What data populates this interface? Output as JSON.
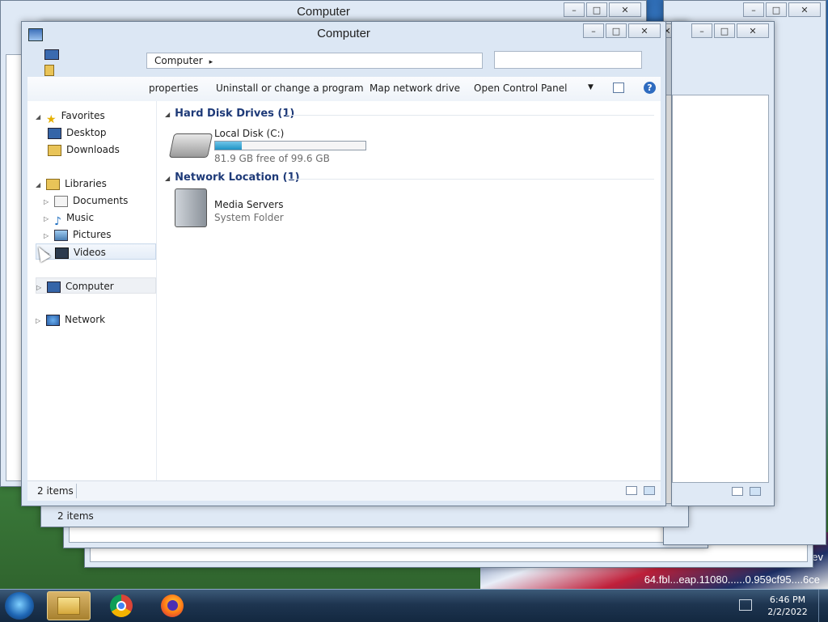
{
  "wallpaper": {
    "text_line1": "eviev",
    "text_line2": "64.fbl...eap.11080......0.959cf95....6ce"
  },
  "background_windows": [
    {
      "title": "Computer",
      "status": "2 items"
    },
    {
      "title": "",
      "status": ""
    },
    {
      "title": "",
      "status": ""
    }
  ],
  "window": {
    "title": "Computer",
    "controls": {
      "minimize": "–",
      "maximize": "□",
      "close": "✕"
    },
    "address": {
      "path": "Computer",
      "separator": "▸"
    },
    "search": {
      "placeholder": ""
    },
    "toolbar": {
      "items": [
        "properties",
        "Uninstall or change a program",
        "Map network drive",
        "Open Control Panel"
      ],
      "help": "?"
    },
    "nav": {
      "favorites": "Favorites",
      "desktop": "Desktop",
      "downloads": "Downloads",
      "libraries": "Libraries",
      "documents": "Documents",
      "music": "Music",
      "pictures": "Pictures",
      "videos": "Videos",
      "computer": "Computer",
      "network": "Network"
    },
    "content": {
      "hdd_group": "Hard Disk Drives (1)",
      "drive_name": "Local Disk (C:)",
      "drive_free_text": "81.9 GB free of 99.6 GB",
      "drive_used_fraction": 0.178,
      "net_group": "Network Location (1)",
      "media_name": "Media Servers",
      "media_type": "System Folder"
    },
    "status": {
      "count": "2 items"
    }
  },
  "taskbar": {
    "apps": [
      "windows-explorer",
      "google-chrome",
      "firefox"
    ],
    "time": "6:46 PM",
    "date": "2/2/2022"
  },
  "colors": {
    "accent": "#1e3a78",
    "progress": "#1f93c4",
    "taskbar": "#1e3550"
  }
}
